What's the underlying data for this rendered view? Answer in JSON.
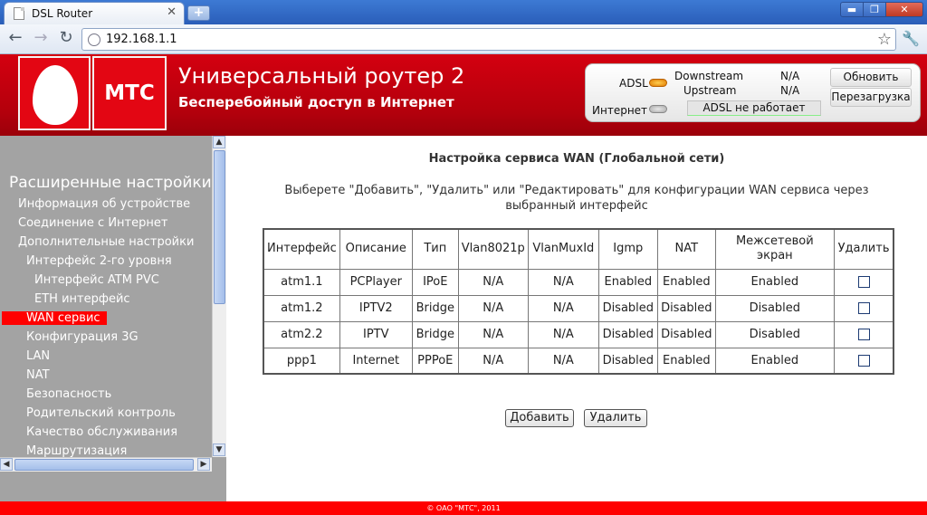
{
  "browser": {
    "tab_title": "DSL Router",
    "tab_close": "✕",
    "new_tab": "+",
    "url": "192.168.1.1",
    "back_icon": "←",
    "forward_icon": "→",
    "reload_icon": "↻",
    "star_icon": "☆",
    "wrench_icon": "🔧",
    "win_min": "▬",
    "win_max": "❐",
    "win_close": "✕"
  },
  "header": {
    "brand": "МТС",
    "title": "Универсальный роутер 2",
    "subtitle": "Бесперебойный доступ в Интернет"
  },
  "status": {
    "adsl_label": "ADSL",
    "internet_label": "Интернет",
    "downstream_label": "Downstream",
    "downstream_value": "N/A",
    "upstream_label": "Upstream",
    "upstream_value": "N/A",
    "adsl_state": "ADSL не работает",
    "refresh_btn": "Обновить",
    "reboot_btn": "Перезагрузка",
    "led_colors": {
      "adsl": "#f0a000",
      "internet": "#b0b0b0"
    }
  },
  "sidebar": {
    "title": "Расширенные настройки",
    "items": [
      "Информация об устройстве",
      "Соединение с Интернет",
      "Дополнительные настройки",
      "Интерфейс 2-го уровня",
      "Интерфейс ATM PVC",
      "ETH интерфейс",
      "WAN сервис",
      "Конфигурация 3G",
      "LAN",
      "NAT",
      "Безопасность",
      "Родительский контроль",
      "Качество обслуживания",
      "Маршрутизация"
    ],
    "active_index": 6
  },
  "main": {
    "title": "Настройка сервиса WAN (Глобальной сети)",
    "description": "Выберете \"Добавить\", \"Удалить\" или \"Редактировать\" для конфигурации WAN сервиса через выбранный интерфейс",
    "table": {
      "headers": [
        "Интерфейс",
        "Описание",
        "Тип",
        "Vlan8021p",
        "VlanMuxId",
        "Igmp",
        "NAT",
        "Межсетевой экран",
        "Удалить"
      ],
      "rows": [
        [
          "atm1.1",
          "PCPlayer",
          "IPoE",
          "N/A",
          "N/A",
          "Enabled",
          "Enabled",
          "Enabled"
        ],
        [
          "atm1.2",
          "IPTV2",
          "Bridge",
          "N/A",
          "N/A",
          "Disabled",
          "Disabled",
          "Disabled"
        ],
        [
          "atm2.2",
          "IPTV",
          "Bridge",
          "N/A",
          "N/A",
          "Disabled",
          "Disabled",
          "Disabled"
        ],
        [
          "ppp1",
          "Internet",
          "PPPoE",
          "N/A",
          "N/A",
          "Disabled",
          "Enabled",
          "Enabled"
        ]
      ]
    },
    "add_btn": "Добавить",
    "delete_btn": "Удалить"
  },
  "footer": "© ОАО \"МТС\", 2011",
  "colors": {
    "brand_red": "#e30613",
    "sidebar_gray": "#a3a3a3",
    "active_item": "#ff0000"
  }
}
